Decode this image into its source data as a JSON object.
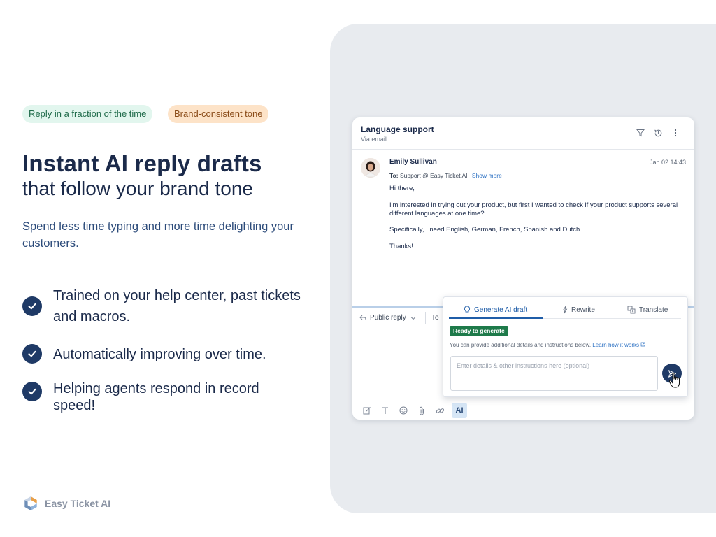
{
  "pills": {
    "reply_speed": "Reply in a fraction of the time",
    "brand_tone": "Brand-consistent tone"
  },
  "hero": {
    "headline": "Instant AI reply drafts",
    "subheadline": "that follow your brand tone",
    "lead": "Spend less time typing and more time delighting your customers."
  },
  "features": [
    "Trained on your help center, past tickets and macros.",
    "Automatically improving over time.",
    "Helping agents respond in record speed!"
  ],
  "brand": {
    "name": "Easy Ticket AI"
  },
  "ticket": {
    "title": "Language support",
    "channel": "Via email",
    "sender": "Emily Sullivan",
    "date": "Jan 02 14:43",
    "to_label": "To:",
    "to_value": "Support @ Easy Ticket AI",
    "show_more": "Show more",
    "body": [
      "Hi there,",
      "I'm interested in trying out your product, but first I wanted to check if your product supports several different languages at one time?",
      "Specifically, I need English, German, French, Spanish and Dutch.",
      "Thanks!"
    ]
  },
  "reply": {
    "mode": "Public reply",
    "to_label": "To"
  },
  "ai_panel": {
    "tabs": [
      "Generate AI draft",
      "Rewrite",
      "Translate"
    ],
    "status": "Ready to generate",
    "hint": "You can provide additional details and instructions below.",
    "learn_link": "Learn how it works",
    "placeholder": "Enter details & other instructions here (optional)"
  },
  "toolbar": {
    "ai_label": "AI"
  },
  "colors": {
    "navy": "#1f3a66",
    "link": "#2f73c4",
    "ready_green": "#1e7a4a",
    "panel_bg": "#e8ebef"
  }
}
